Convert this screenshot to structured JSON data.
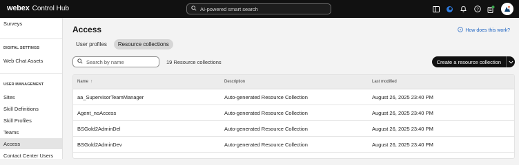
{
  "topbar": {
    "brand_logo": "webex",
    "brand_name": "Control Hub",
    "search_placeholder": "AI-powered smart search",
    "icons": [
      "layout-icon",
      "ai-assistant-icon",
      "bell-icon",
      "help-icon",
      "tasks-icon",
      "avatar-icon"
    ],
    "colors": {
      "background": "#111111",
      "accent": "#1b62c2"
    }
  },
  "sidebar": {
    "top_item": "Surveys",
    "sections": [
      {
        "heading": "DIGITAL SETTINGS",
        "items": [
          "Web Chat Assets"
        ]
      },
      {
        "heading": "USER MANAGEMENT",
        "items": [
          "Sites",
          "Skill Definitions",
          "Skill Profiles",
          "Teams",
          "Access",
          "Contact Center Users"
        ]
      }
    ],
    "active_item": "Access"
  },
  "main": {
    "title": "Access",
    "help_link": "How does this work?",
    "tabs": [
      {
        "label": "User profiles",
        "active": false
      },
      {
        "label": "Resource collections",
        "active": true
      }
    ],
    "search_placeholder": "Search by name",
    "count_text": "19 Resource collections",
    "create_button": "Create a resource collection"
  },
  "table": {
    "columns": [
      "Name",
      "Description",
      "Last modified"
    ],
    "sort_indicator": "↑",
    "rows": [
      {
        "name": "aa_SupervisorTeamManager",
        "description": "Auto-generated Resource Collection",
        "modified": "August 26, 2025 23:40 PM"
      },
      {
        "name": "Agent_noAccess",
        "description": "Auto-generated Resource Collection",
        "modified": "August 26, 2025 23:40 PM"
      },
      {
        "name": "BSGold2AdminDel",
        "description": "Auto-generated Resource Collection",
        "modified": "August 26, 2025 23:40 PM"
      },
      {
        "name": "BSGold2AdminDev",
        "description": "Auto-generated Resource Collection",
        "modified": "August 26, 2025 23:40 PM"
      }
    ]
  }
}
